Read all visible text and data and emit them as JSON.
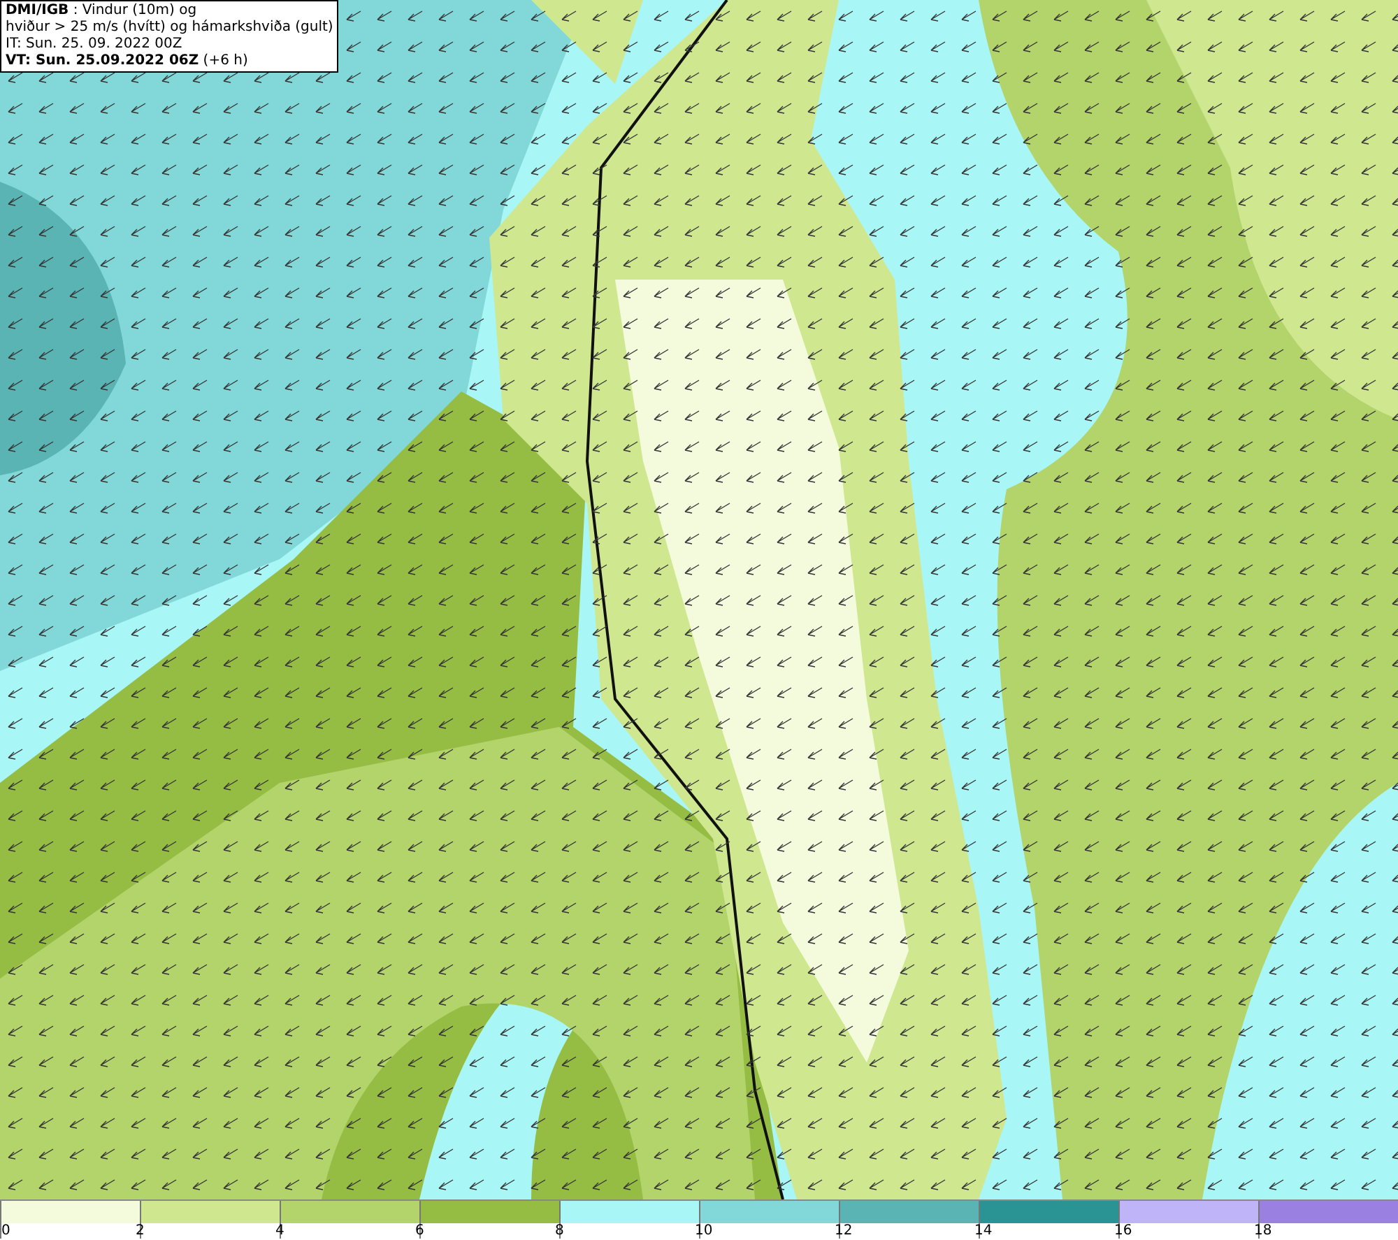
{
  "header": {
    "lines": [
      "**DMI/IGB** : Vindur (10m) og",
      "hviður > 25 m/s (hvítt) og hámarkshviða (gult)",
      "IT: Sun. 25. 09. 2022 00Z",
      "**VT: Sun. 25.09.2022 06Z** (+6 h)"
    ]
  },
  "legend": {
    "bins": [
      {
        "tick": "0",
        "color": "#f4fadc"
      },
      {
        "tick": "2",
        "color": "#cfe890"
      },
      {
        "tick": "4",
        "color": "#b2d46a"
      },
      {
        "tick": "6",
        "color": "#96bd43"
      },
      {
        "tick": "8",
        "color": "#a9f6f6"
      },
      {
        "tick": "10",
        "color": "#82d8d8"
      },
      {
        "tick": "12",
        "color": "#5bb4b4"
      },
      {
        "tick": "14",
        "color": "#2a9494"
      },
      {
        "tick": "16",
        "color": "#c0b4f8"
      },
      {
        "tick": "18",
        "color": "#9a80e0"
      }
    ]
  }
}
